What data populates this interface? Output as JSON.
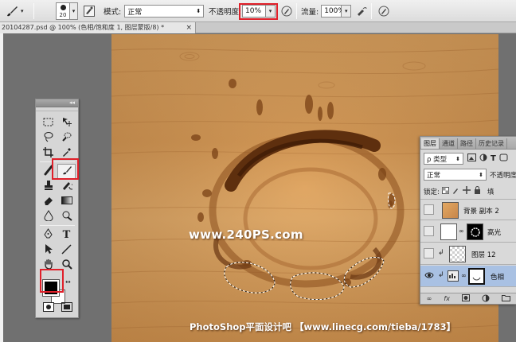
{
  "options_bar": {
    "brush_size": "20",
    "mode_label": "模式:",
    "mode_value": "正常",
    "opacity_label": "不透明度:",
    "opacity_value": "10%",
    "flow_label": "流量:",
    "flow_value": "100%"
  },
  "document_tab": {
    "title": "20104287.psd @ 100% (色相/饱和度 1, 图层蒙版/8) *",
    "close": "×"
  },
  "tools_panel": {
    "collapse": "◂◂",
    "close": "×",
    "type_tool_label": "T"
  },
  "layers_panel": {
    "tabs": [
      {
        "label": "图层",
        "active": true
      },
      {
        "label": "通道",
        "active": false
      },
      {
        "label": "路径",
        "active": false
      },
      {
        "label": "历史记录",
        "active": false
      }
    ],
    "filter_kind": "ρ 类型",
    "blend_mode": "正常",
    "opacity_label": "不透明度",
    "lock_label": "锁定:",
    "fill_label": "填",
    "layers": [
      {
        "name": "背景 副本 2",
        "thumb": "wood",
        "selected": false
      },
      {
        "name": "高光",
        "thumb": "white-mask",
        "selected": false
      },
      {
        "name": "图层 12",
        "thumb": "transparent",
        "selected": false
      },
      {
        "name": "色相",
        "thumb": "adjust-mask",
        "selected": true
      }
    ],
    "footer_icons": [
      "link-icon",
      "fx-icon",
      "mask-icon",
      "adjust-icon",
      "folder-icon"
    ],
    "footer_fx": "fx"
  },
  "canvas": {
    "watermark_url": "www.240PS.com",
    "watermark_credit": "PhotoShop平面设计吧 【www.linecg.com/tieba/1783】"
  },
  "colors": {
    "foreground": "#000000",
    "background": "#ffffff",
    "highlight": "#e0202a",
    "selection": "#a9c1e3"
  }
}
